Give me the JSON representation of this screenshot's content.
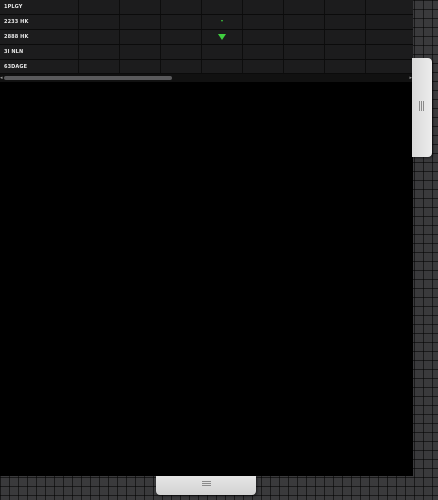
{
  "table": {
    "rows": [
      {
        "label": "1PLGY",
        "markers": []
      },
      {
        "label": "2233 HK",
        "markers": [
          {
            "col": 3,
            "icon": "down-triangle-icon",
            "size": "small",
            "color": "#3fcf3f"
          }
        ]
      },
      {
        "label": "2888 HK",
        "markers": [
          {
            "col": 3,
            "icon": "down-triangle-icon",
            "size": "large",
            "color": "#3fcf3f"
          }
        ]
      },
      {
        "label": "3I NLN",
        "markers": []
      },
      {
        "label": "63DAGE",
        "markers": []
      }
    ],
    "data_column_count": 8
  },
  "scrollbar": {
    "left_arrow": "◂",
    "right_arrow": "▸"
  },
  "colors": {
    "panel_background": "#000000",
    "table_background": "#1c1c1d",
    "marker_green": "#3fcf3f",
    "workspace_grid": "#3a3a3c",
    "handle": "#e6e6e6"
  }
}
